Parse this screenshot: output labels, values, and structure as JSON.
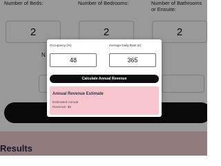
{
  "background_page": {
    "fields": [
      {
        "label": "Number of Beds:",
        "value": "2"
      },
      {
        "label": "Number of Bedrooms:",
        "value": "2"
      },
      {
        "label": "Number of Bathrooms or Ensuite:",
        "value": "2"
      }
    ],
    "partial_label": "N",
    "results_heading": "Results"
  },
  "modal": {
    "occupancy": {
      "label": "Occupancy (%)",
      "value": "48"
    },
    "rate": {
      "label": "Average Daily Rate (£)",
      "value": "365"
    },
    "calculate_label": "Calculate Annual Revenue",
    "result": {
      "title": "Annual Revenue Estimate",
      "line1": "Estimated Annual",
      "line2": "Revenue: $0"
    }
  },
  "colors": {
    "overlay": "rgba(0,0,0,0.4)",
    "button": "#0d0d0d",
    "result_bg": "#f7c5cb",
    "result_title": "#2a3452"
  }
}
